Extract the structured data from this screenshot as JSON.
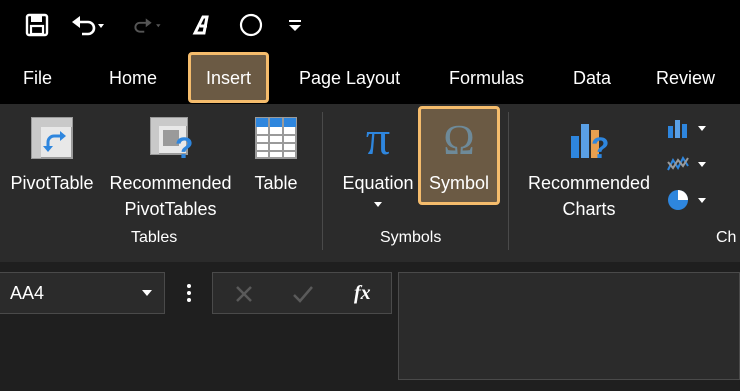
{
  "quick_access": {
    "icons": [
      "save-icon",
      "undo-icon",
      "redo-icon",
      "touch-mode-icon",
      "shape-icon",
      "customize-toolbar-icon"
    ]
  },
  "tabs": [
    {
      "label": "File",
      "active": false
    },
    {
      "label": "Home",
      "active": false
    },
    {
      "label": "Insert",
      "active": true
    },
    {
      "label": "Page Layout",
      "active": false
    },
    {
      "label": "Formulas",
      "active": false
    },
    {
      "label": "Data",
      "active": false
    },
    {
      "label": "Review",
      "active": false
    }
  ],
  "ribbon": {
    "tables": {
      "pivot_table": "PivotTable",
      "recommended_line1": "Recommended",
      "recommended_line2": "PivotTables",
      "table": "Table",
      "group_label": "Tables"
    },
    "symbols": {
      "equation": "Equation",
      "symbol": "Symbol",
      "group_label": "Symbols",
      "highlight_color": "#f5bc6c"
    },
    "charts": {
      "recommended_line1": "Recommended",
      "recommended_line2": "Charts",
      "group_label_partial": "Ch"
    }
  },
  "formula_bar": {
    "name_box": "AA4",
    "fx_label": "fx",
    "formula_value": ""
  },
  "colors": {
    "accent_border": "#f5bc6c",
    "active_fill": "#6b5a44",
    "blue_icon": "#2e86de"
  }
}
